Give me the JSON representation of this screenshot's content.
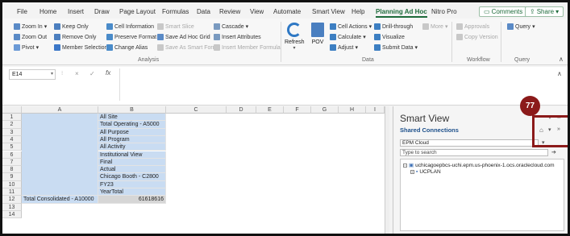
{
  "menu": {
    "tabs": [
      "File",
      "Home",
      "Insert",
      "Draw",
      "Page Layout",
      "Formulas",
      "Data",
      "Review",
      "View",
      "Automate",
      "Smart View",
      "Help",
      "Planning Ad Hoc",
      "Nitro Pro"
    ],
    "active": "Planning Ad Hoc",
    "comments": "Comments",
    "share": "Share"
  },
  "ribbon": {
    "zoom_in": "Zoom In",
    "zoom_out": "Zoom Out",
    "pivot": "Pivot",
    "keep_only": "Keep Only",
    "remove_only": "Remove Only",
    "member_selection": "Member Selection",
    "cell_information": "Cell Information",
    "preserve_format": "Preserve Format",
    "change_alias": "Change Alias",
    "smart_slice": "Smart Slice",
    "save_ad_hoc_grid": "Save Ad Hoc Grid",
    "save_as_smart_form": "Save As Smart Form",
    "cascade": "Cascade",
    "insert_attributes": "Insert Attributes",
    "insert_member_formula": "Insert Member Formula",
    "refresh": "Refresh",
    "pov": "POV",
    "cell_actions": "Cell Actions",
    "calculate": "Calculate",
    "adjust": "Adjust",
    "drill_through": "Drill-through",
    "visualize": "Visualize",
    "submit_data": "Submit Data",
    "more": "More",
    "approvals": "Approvals",
    "copy_version": "Copy Version",
    "query": "Query",
    "groups": {
      "analysis": "Analysis",
      "data": "Data",
      "workflow": "Workflow",
      "query": "Query"
    }
  },
  "formula": {
    "name_box": "E14",
    "cancel": "×",
    "enter": "✓",
    "fx": "fx"
  },
  "grid": {
    "columns": [
      "A",
      "B",
      "C",
      "D",
      "E",
      "F",
      "G",
      "H",
      "I"
    ],
    "rows": [
      "1",
      "2",
      "3",
      "4",
      "5",
      "6",
      "7",
      "8",
      "9",
      "10",
      "11",
      "12",
      "13",
      "14"
    ],
    "b_values": [
      "All Site",
      "Total Operating - A5000",
      "All Purpose",
      "All Program",
      "All Activity",
      "Institutional View",
      "Final",
      "Actual",
      "Chicago Booth - C2800",
      "FY23",
      "YearTotal"
    ],
    "a12": "Total Consolidated - A10000",
    "b12": "61618616"
  },
  "smartview": {
    "title": "Smart View",
    "shared": "Shared Connections",
    "connection": "EPM Cloud",
    "search_placeholder": "Type to search",
    "tree_root": "uchicagoepbcs-uchi.epm.us-phoenix-1.ocs.oraclecloud.com",
    "tree_child": "UCPLAN"
  },
  "callout": {
    "number": "77"
  },
  "colors": {
    "accent": "#1e6b3b",
    "highlight": "#c9dcf2",
    "callout": "#8b1a1a",
    "link": "#1c4f8a"
  }
}
